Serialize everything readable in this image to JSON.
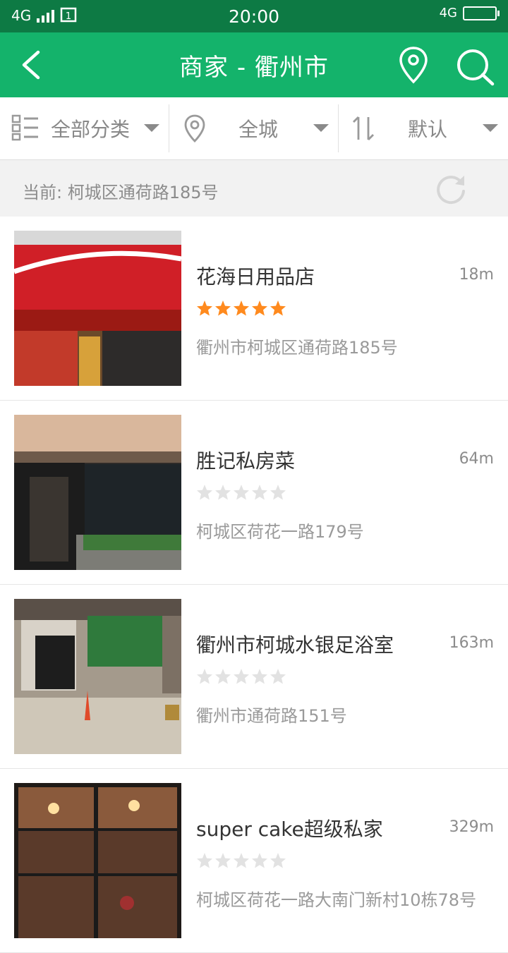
{
  "status": {
    "network_left": "4G",
    "time": "20:00",
    "network_right": "4G"
  },
  "header": {
    "title": "商家 - 衢州市"
  },
  "filters": {
    "category": "全部分类",
    "area": "全城",
    "sort": "默认"
  },
  "location": {
    "current": "当前: 柯城区通荷路185号"
  },
  "colors": {
    "primary": "#14b36b",
    "statusbar": "#0d7a44",
    "star_on": "#ff8a1e",
    "star_off": "#e2e2e2"
  },
  "stores": [
    {
      "name": "花海日用品店",
      "distance": "18m",
      "rating": 5,
      "address": "衢州市柯城区通荷路185号"
    },
    {
      "name": "胜记私房菜",
      "distance": "64m",
      "rating": 0,
      "address": "柯城区荷花一路179号"
    },
    {
      "name": "衢州市柯城水银足浴室",
      "distance": "163m",
      "rating": 0,
      "address": "衢州市通荷路151号"
    },
    {
      "name": "super cake超级私家",
      "distance": "329m",
      "rating": 0,
      "address": "柯城区荷花一路大南门新村10栋78号"
    }
  ]
}
